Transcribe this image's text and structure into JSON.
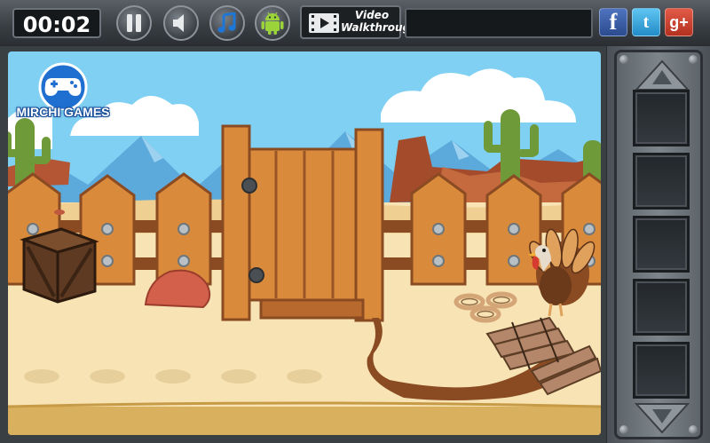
{
  "hud": {
    "timer": "00:02",
    "video_line1": "Video",
    "video_line2": "Walkthrough"
  },
  "icons": {
    "pause": "pause-icon",
    "sound": "speaker-icon",
    "music": "music-note-icon",
    "android": "android-icon",
    "video": "film-icon"
  },
  "social": {
    "facebook": "f",
    "twitter": "t",
    "google_plus": "g+"
  },
  "branding": {
    "logo_text": "MIRCHI GAMES"
  },
  "inventory": {
    "slots": [
      {
        "item": ""
      },
      {
        "item": ""
      },
      {
        "item": ""
      },
      {
        "item": ""
      },
      {
        "item": ""
      }
    ]
  },
  "colors": {
    "sky": "#7fd0f2",
    "sand": "#f7e3b4",
    "wood": "#d98a3a",
    "fb": "#3b5998",
    "tw": "#33a7e0",
    "gp": "#d34836"
  }
}
